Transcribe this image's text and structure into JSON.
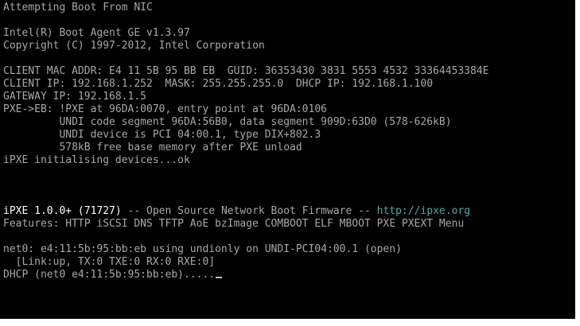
{
  "console": {
    "lines": {
      "boot_attempt": "Attempting Boot From NIC",
      "agent_version": "Intel(R) Boot Agent GE v1.3.97",
      "copyright": "Copyright (C) 1997-2012, Intel Corporation",
      "client_mac": "CLIENT MAC ADDR: E4 11 5B 95 BB EB  GUID: 36353430 3831 5553 4532 33364453384E",
      "client_ip": "CLIENT IP: 192.168.1.252  MASK: 255.255.255.0  DHCP IP: 192.168.1.100",
      "gateway_ip": "GATEWAY IP: 192.168.1.5",
      "pxe_entry": "PXE->EB: !PXE at 96DA:0070, entry point at 96DA:0106",
      "undi_segment": "         UNDI code segment 96DA:56B0, data segment 909D:63D0 (578-626kB)",
      "undi_device": "         UNDI device is PCI 04:00.1, type DIX+802.3",
      "base_memory": "         578kB free base memory after PXE unload",
      "ipxe_init": "iPXE initialising devices...ok",
      "ipxe_version": "iPXE 1.0.0+ (71727)",
      "ipxe_description": " -- Open Source Network Boot Firmware -- ",
      "ipxe_url": "http://ipxe.org",
      "features": "Features: HTTP iSCSI DNS TFTP AoE bzImage COMBOOT ELF MBOOT PXE PXEXT Menu",
      "net0_status": "net0: e4:11:5b:95:bb:eb using undionly on UNDI-PCI04:00.1 (open)",
      "link_status": "  [Link:up, TX:0 TXE:0 RX:0 RXE:0]",
      "dhcp_status": "DHCP (net0 e4:11:5b:95:bb:eb)....."
    }
  },
  "colors": {
    "background": "#000000",
    "text": "#a8a8a8",
    "bright_text": "#ffffff",
    "link": "#54a8a8"
  }
}
